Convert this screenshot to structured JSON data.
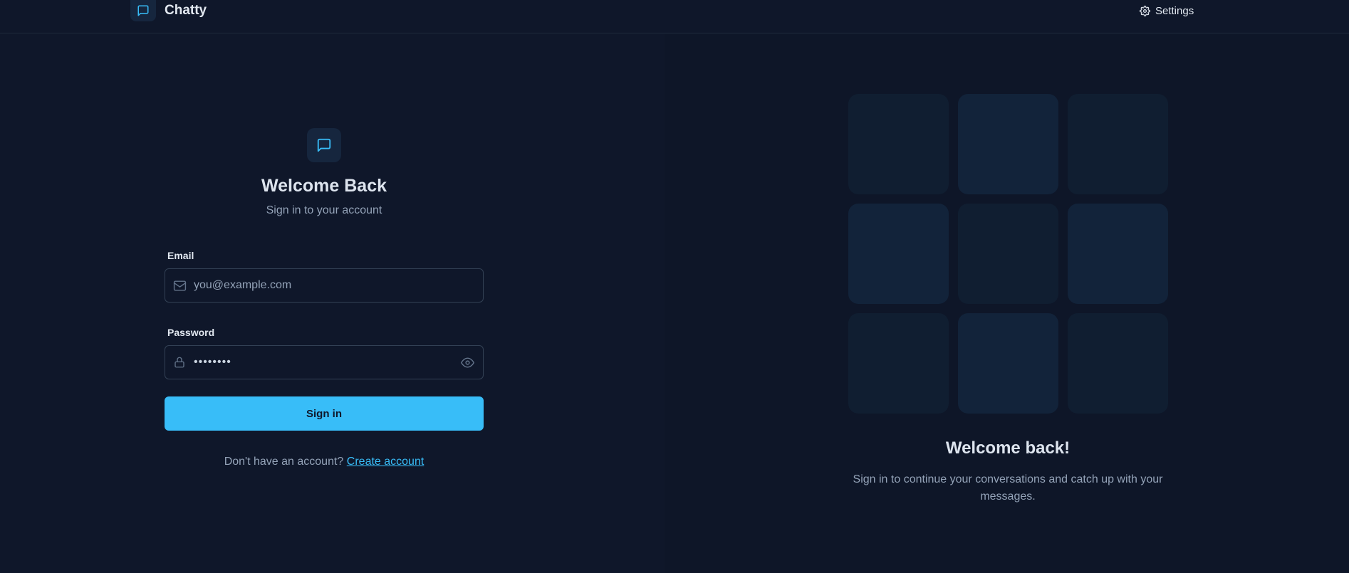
{
  "app": {
    "name": "Chatty",
    "logo_icon": "message-square-icon",
    "accent_color": "#38bdf8"
  },
  "header": {
    "settings_label": "Settings",
    "settings_icon": "gear-icon"
  },
  "login": {
    "icon": "message-square-icon",
    "title": "Welcome Back",
    "subtitle": "Sign in to your account",
    "email": {
      "label": "Email",
      "placeholder": "you@example.com",
      "value": "",
      "icon": "mail-icon"
    },
    "password": {
      "label": "Password",
      "masked_value": "••••••••",
      "icon": "lock-icon",
      "toggle_icon": "eye-icon"
    },
    "submit_label": "Sign in",
    "signup_prompt": "Don't have an account?",
    "signup_link": "Create account"
  },
  "promo": {
    "title": "Welcome back!",
    "text": "Sign in to continue your conversations and catch up with your messages.",
    "tile_count": 9
  }
}
